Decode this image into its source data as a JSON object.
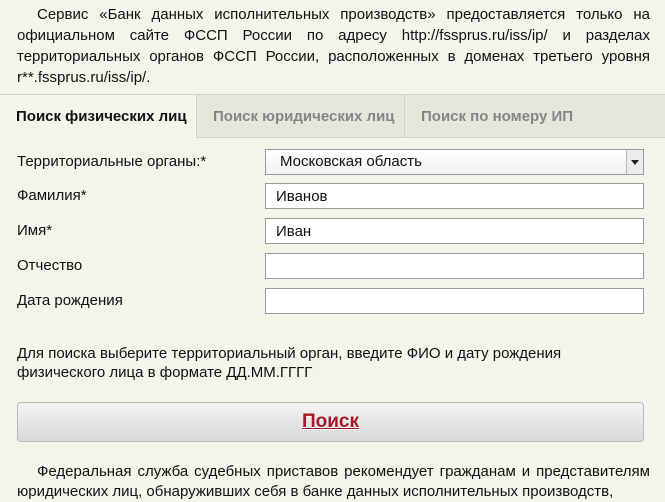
{
  "intro": {
    "text": "Сервис «Банк данных исполнительных производств» предоставляется только на официальном сайте ФССП России по адресу http://fssprus.ru/iss/ip/ и разделах территориальных органов ФССП России, расположенных в доменах третьего уровня r**.fssprus.ru/iss/ip/."
  },
  "tabs": [
    {
      "label": "Поиск физических лиц",
      "active": true
    },
    {
      "label": "Поиск юридических лиц",
      "active": false
    },
    {
      "label": "Поиск по номеру ИП",
      "active": false
    }
  ],
  "form": {
    "region": {
      "label": "Территориальные органы:*",
      "value": "Московская область"
    },
    "last_name": {
      "label": "Фамилия*",
      "value": "Иванов"
    },
    "first_name": {
      "label": "Имя*",
      "value": "Иван"
    },
    "patronymic": {
      "label": "Отчество",
      "value": ""
    },
    "birth_date": {
      "label": "Дата рождения",
      "value": ""
    }
  },
  "hint": "Для поиска выберите территориальный орган, введите ФИО и дату рождения физического лица в формате ДД.ММ.ГГГГ",
  "search_button": {
    "label": "Поиск"
  },
  "footer": {
    "text": "Федеральная служба судебных приставов рекомендует гражданам и представителям юридических лиц, обнаруживших себя в банке данных исполнительных производств,"
  },
  "colors": {
    "background": "#f4f4ea",
    "tab_bar": "#e6e7dc",
    "button_text": "#a4182c"
  }
}
